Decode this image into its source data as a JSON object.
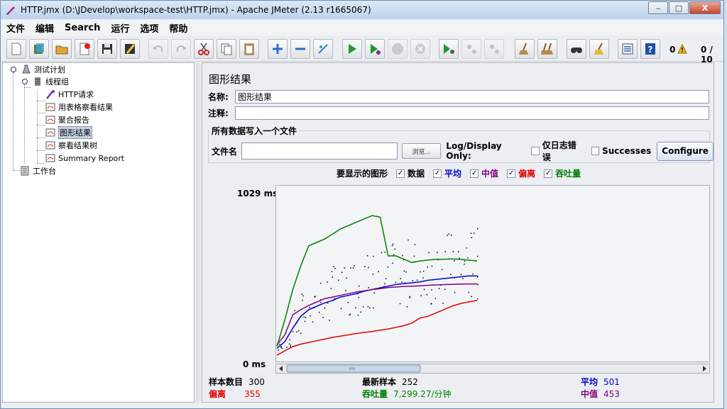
{
  "window": {
    "title": "HTTP.jmx (D:\\JDevelop\\workspace-test\\HTTP.jmx) - Apache JMeter (2.13 r1665067)",
    "minimize": "‒",
    "maximize": "□",
    "close": "X"
  },
  "menu": [
    "文件",
    "编辑",
    "Search",
    "运行",
    "选项",
    "帮助"
  ],
  "toolbar": {
    "warnings_count": "0",
    "threads": "0 / 10"
  },
  "tree": {
    "test_plan": "测试计划",
    "thread_group": "线程组",
    "http_request": "HTTP请求",
    "table_results": "用表格察看结果",
    "aggregate_report": "聚合报告",
    "graph_results": "图形结果",
    "results_tree": "察看结果树",
    "summary_report": "Summary Report",
    "workbench": "工作台"
  },
  "panel": {
    "title": "图形结果",
    "name_label": "名称:",
    "name_value": "图形结果",
    "comment_label": "注释:",
    "comment_value": "",
    "file_group_title": "所有数据写入一个文件",
    "filename_label": "文件名",
    "filename_value": "",
    "browse_label": "浏览...",
    "log_display_only": "Log/Display Only:",
    "errors_only": "仅日志错误",
    "successes": "Successes",
    "configure": "Configure",
    "graphs_to_display": "要显示的图形"
  },
  "legend": [
    {
      "label": "数据",
      "color": "#000000"
    },
    {
      "label": "平均",
      "color": "#0000cc"
    },
    {
      "label": "中值",
      "color": "#800080"
    },
    {
      "label": "偏离",
      "color": "#e00000"
    },
    {
      "label": "吞吐量",
      "color": "#008000"
    }
  ],
  "chart_data": {
    "type": "line",
    "y_max_label": "1029 ms",
    "y_min_label": "0 ms",
    "ylim": [
      0,
      1029
    ],
    "series": [
      {
        "name": "平均",
        "color": "#0000cc",
        "x": [
          0,
          10,
          20,
          30,
          40,
          50,
          60,
          70,
          80,
          90,
          100,
          110,
          120,
          130,
          140,
          150,
          160,
          170,
          180,
          190,
          200,
          210,
          220,
          230,
          240,
          252
        ],
        "values": [
          70,
          110,
          190,
          260,
          300,
          320,
          340,
          355,
          375,
          385,
          395,
          410,
          420,
          430,
          440,
          450,
          455,
          460,
          465,
          475,
          480,
          485,
          490,
          495,
          500,
          501
        ]
      },
      {
        "name": "中值",
        "color": "#800080",
        "x": [
          0,
          10,
          20,
          30,
          40,
          50,
          60,
          70,
          80,
          90,
          100,
          110,
          120,
          130,
          140,
          150,
          160,
          170,
          180,
          190,
          200,
          210,
          220,
          230,
          240,
          252
        ],
        "values": [
          90,
          150,
          270,
          300,
          325,
          345,
          365,
          375,
          385,
          395,
          405,
          412,
          420,
          425,
          432,
          435,
          438,
          440,
          442,
          445,
          447,
          449,
          450,
          452,
          453,
          453
        ]
      },
      {
        "name": "偏离",
        "color": "#e00000",
        "x": [
          0,
          10,
          20,
          30,
          40,
          50,
          60,
          70,
          80,
          90,
          100,
          110,
          120,
          130,
          140,
          150,
          160,
          170,
          180,
          190,
          200,
          210,
          220,
          230,
          240,
          252
        ],
        "values": [
          30,
          55,
          80,
          95,
          105,
          115,
          125,
          135,
          142,
          150,
          158,
          165,
          170,
          178,
          185,
          195,
          205,
          220,
          250,
          260,
          280,
          300,
          320,
          335,
          345,
          355
        ]
      },
      {
        "name": "吞吐量",
        "color": "#008000",
        "x": [
          0,
          10,
          20,
          30,
          40,
          50,
          60,
          70,
          80,
          90,
          100,
          110,
          120,
          130,
          140,
          150,
          160,
          170,
          180,
          190,
          200,
          210,
          220,
          230,
          240,
          252
        ],
        "values": [
          80,
          240,
          420,
          560,
          680,
          700,
          720,
          750,
          780,
          800,
          820,
          840,
          860,
          850,
          620,
          620,
          600,
          580,
          590,
          595,
          600,
          600,
          602,
          600,
          595,
          590
        ]
      }
    ]
  },
  "stats": {
    "samples_label": "样本数目",
    "samples_value": "300",
    "latest_label": "最新样本",
    "latest_value": "252",
    "average_label": "平均",
    "average_value": "501",
    "deviation_label": "偏离",
    "deviation_value": "355",
    "throughput_label": "吞吐量",
    "throughput_value": "7,299.27/分钟",
    "median_label": "中值",
    "median_value": "453"
  }
}
